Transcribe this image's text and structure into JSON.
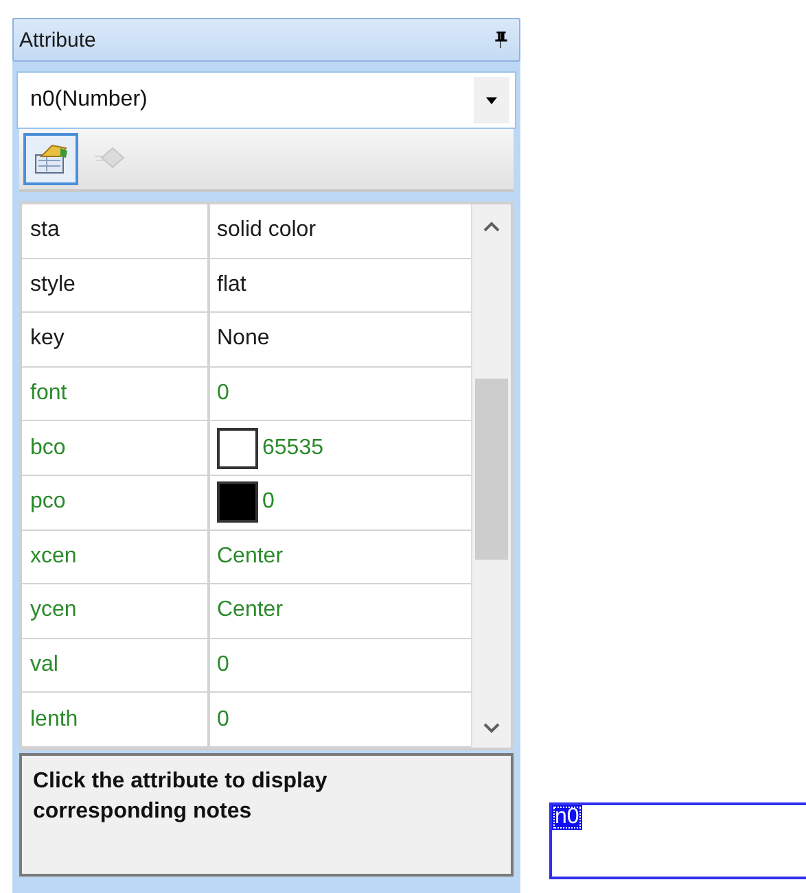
{
  "panel": {
    "title": "Attribute"
  },
  "object_selector": {
    "value": "n0(Number)"
  },
  "toolbar": [
    {
      "kind": "properties",
      "selected": true
    },
    {
      "kind": "events",
      "selected": false,
      "disabled": true
    }
  ],
  "properties": [
    {
      "name": "sta",
      "value": "solid color",
      "modified": false
    },
    {
      "name": "style",
      "value": "flat",
      "modified": false
    },
    {
      "name": "key",
      "value": "None",
      "modified": false
    },
    {
      "name": "font",
      "value": "0",
      "modified": true
    },
    {
      "name": "bco",
      "value": "65535",
      "modified": true,
      "color": "#ffffff"
    },
    {
      "name": "pco",
      "value": "0",
      "modified": true,
      "color": "#000000"
    },
    {
      "name": "xcen",
      "value": "Center",
      "modified": true
    },
    {
      "name": "ycen",
      "value": "Center",
      "modified": true
    },
    {
      "name": "val",
      "value": "0",
      "modified": true
    },
    {
      "name": "lenth",
      "value": "0",
      "modified": true
    }
  ],
  "description": "Click the attribute to display corresponding notes",
  "canvas": {
    "objects": [
      {
        "label": "n0",
        "selected": true
      }
    ]
  }
}
